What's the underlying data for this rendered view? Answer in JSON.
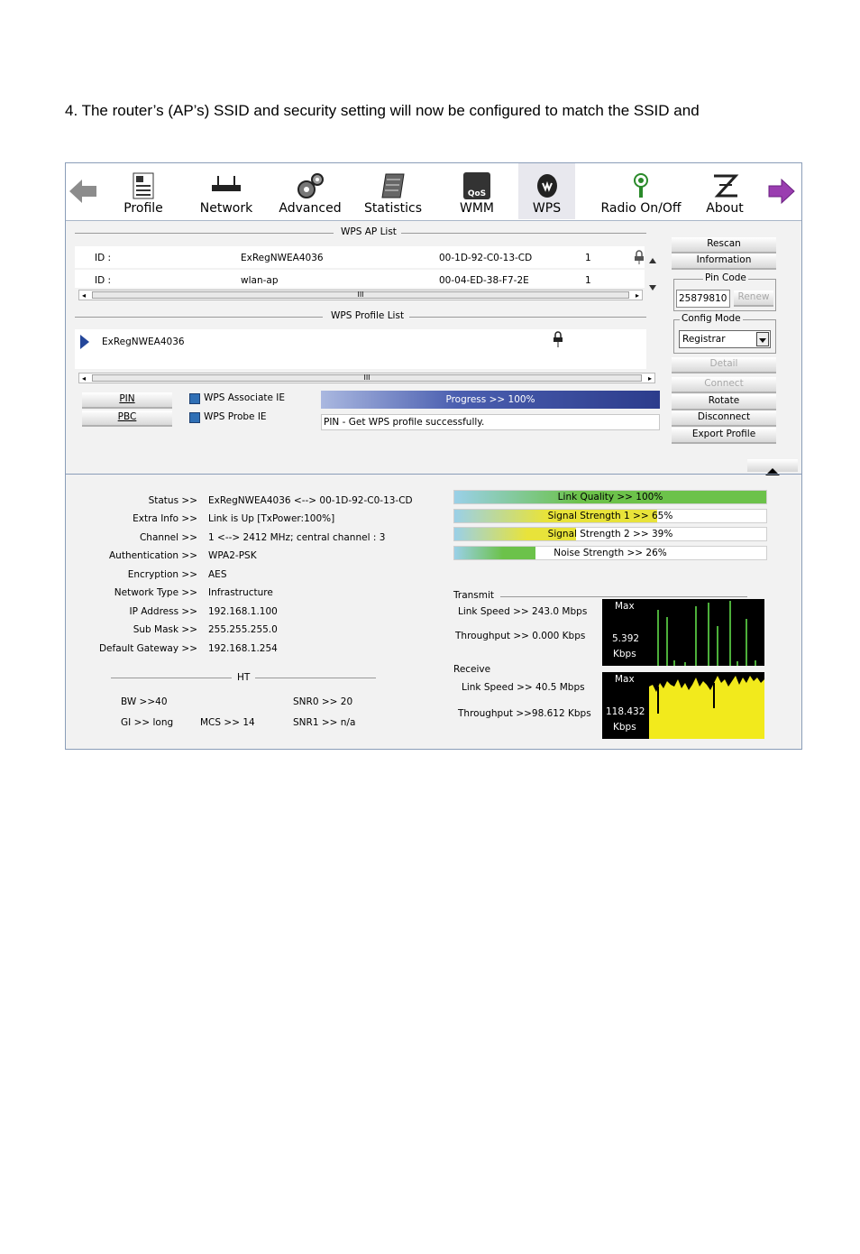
{
  "paragraph": "4. The router’s (AP’s) SSID and security setting will now be configured to match the SSID and",
  "toolbar": {
    "items": [
      {
        "label": "Profile"
      },
      {
        "label": "Network"
      },
      {
        "label": "Advanced"
      },
      {
        "label": "Statistics"
      },
      {
        "label": "WMM",
        "icon_text": "QoS"
      },
      {
        "label": "WPS"
      },
      {
        "label": "Radio On/Off"
      },
      {
        "label": "About"
      }
    ],
    "active": "WPS"
  },
  "ap_list": {
    "title": "WPS AP List",
    "rows": [
      {
        "id_label": "ID :",
        "ssid": "ExRegNWEA4036",
        "bssid": "00-1D-92-C0-13-CD",
        "channel": "1"
      },
      {
        "id_label": "ID :",
        "ssid": "wlan-ap",
        "bssid": "00-04-ED-38-F7-2E",
        "channel": "1"
      }
    ],
    "scroll_grip": "III"
  },
  "profile_list": {
    "title": "WPS Profile List",
    "items": [
      "ExRegNWEA4036"
    ],
    "scroll_grip": "III"
  },
  "buttons": {
    "pin": "PIN",
    "pbc": "PBC",
    "rescan": "Rescan",
    "information": "Information",
    "renew": "Renew",
    "detail": "Detail",
    "connect": "Connect",
    "rotate": "Rotate",
    "disconnect": "Disconnect",
    "export_profile": "Export Profile"
  },
  "checkboxes": {
    "associate_ie": "WPS Associate IE",
    "probe_ie": "WPS Probe IE"
  },
  "progress": {
    "label": "Progress >> 100%",
    "percent": 100
  },
  "message": "PIN - Get WPS profile successfully.",
  "pin_code": {
    "title": "Pin Code",
    "value": "25879810"
  },
  "config_mode": {
    "title": "Config Mode",
    "value": "Registrar"
  },
  "status": {
    "rows": [
      {
        "label": "Status >>",
        "value": "ExRegNWEA4036 <--> 00-1D-92-C0-13-CD"
      },
      {
        "label": "Extra Info >>",
        "value": "Link is Up [TxPower:100%]"
      },
      {
        "label": "Channel >>",
        "value": "1 <--> 2412 MHz; central channel : 3"
      },
      {
        "label": "Authentication >>",
        "value": "WPA2-PSK"
      },
      {
        "label": "Encryption >>",
        "value": "AES"
      },
      {
        "label": "Network Type >>",
        "value": "Infrastructure"
      },
      {
        "label": "IP Address >>",
        "value": "192.168.1.100"
      },
      {
        "label": "Sub Mask >>",
        "value": "255.255.255.0"
      },
      {
        "label": "Default Gateway >>",
        "value": "192.168.1.254"
      }
    ]
  },
  "ht": {
    "title": "HT",
    "bw": "BW >>40",
    "gi": "GI >> long",
    "mcs": "MCS >>   14",
    "snr0": "SNR0 >>   20",
    "snr1": "SNR1 >>  n/a"
  },
  "quality": {
    "link_quality": {
      "label": "Link Quality >> 100%",
      "percent": 100
    },
    "signal1": {
      "label": "Signal Strength 1 >> 65%",
      "percent": 65
    },
    "signal2": {
      "label": "Signal Strength 2 >> 39%",
      "percent": 39
    },
    "noise": {
      "label": "Noise Strength >> 26%",
      "percent": 26
    }
  },
  "transmit": {
    "title": "Transmit",
    "link_speed": "Link Speed >>  243.0 Mbps",
    "throughput": "Throughput >> 0.000 Kbps",
    "graph_max": "Max",
    "graph_value": "5.392",
    "graph_unit": "Kbps"
  },
  "receive": {
    "title": "Receive",
    "link_speed": "Link Speed >> 40.5 Mbps",
    "throughput": "Throughput >>98.612 Kbps",
    "graph_max": "Max",
    "graph_value": "118.432",
    "graph_unit": "Kbps"
  },
  "colors": {
    "progress_fill": "#4b5fb0",
    "link_quality": "#6cc24a",
    "signal": "#e8e33a",
    "noise": "#6cc24a",
    "tx_graph": "#4caf3a",
    "rx_graph": "#f2ea1c"
  }
}
